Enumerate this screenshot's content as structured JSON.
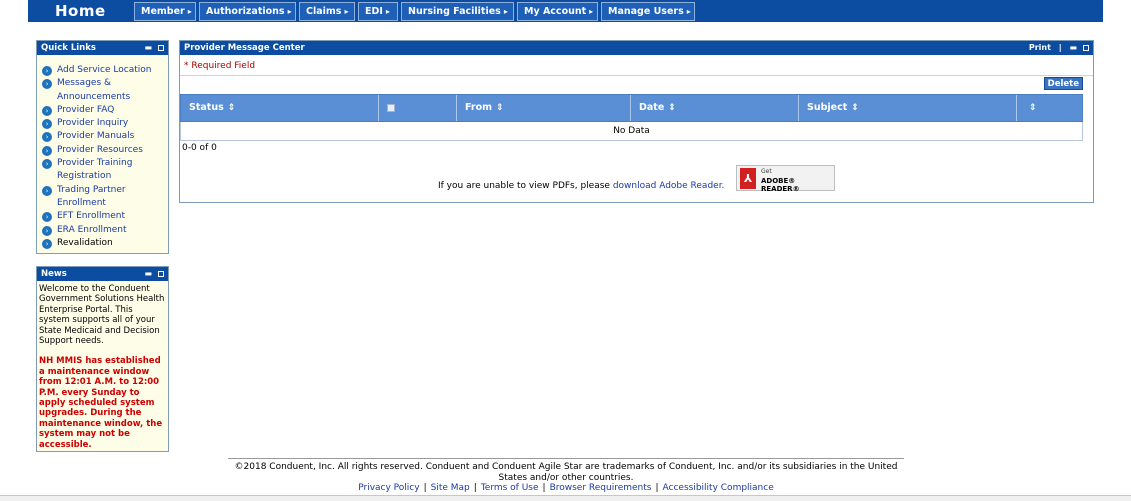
{
  "nav": {
    "home": "Home",
    "menus": [
      "Member",
      "Authorizations",
      "Claims",
      "EDI",
      "Nursing Facilities",
      "My Account",
      "Manage Users"
    ]
  },
  "quick_links": {
    "title": "Quick Links",
    "items": [
      "Add Service Location",
      "Messages & Announcements",
      "Provider FAQ",
      "Provider Inquiry",
      "Provider Manuals",
      "Provider Resources",
      "Provider Training Registration",
      "Trading Partner Enrollment",
      "EFT Enrollment",
      "ERA Enrollment",
      "Revalidation"
    ]
  },
  "news": {
    "title": "News",
    "welcome": "Welcome to the Conduent Government Solutions Health Enterprise Portal. This system supports all of your State Medicaid and Decision Support needs.",
    "notice": "NH MMIS has established a maintenance window from 12:01 A.M. to 12:00 P.M. every Sunday to apply scheduled system upgrades. During the maintenance window, the system may not be accessible."
  },
  "message_center": {
    "title": "Provider Message Center",
    "print": "Print",
    "required": "* Required Field",
    "delete": "Delete",
    "columns": [
      "Status",
      "From",
      "Date",
      "Subject"
    ],
    "no_data": "No Data",
    "count": "0-0 of 0",
    "pdf_text": "If you are unable to view PDFs, please",
    "pdf_link": "download Adobe Reader.",
    "adobe_get": "Get",
    "adobe_reader": "ADOBE® READER®"
  },
  "footer": {
    "copyright": "©2018 Conduent, Inc. All rights reserved. Conduent and Conduent Agile Star are trademarks of Conduent, Inc. and/or its subsidiaries in the United States and/or other countries.",
    "links": [
      "Privacy Policy",
      "Site Map",
      "Terms of Use",
      "Browser Requirements",
      "Accessibility Compliance"
    ]
  }
}
